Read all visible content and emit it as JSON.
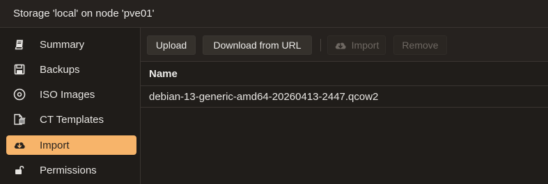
{
  "window": {
    "title": "Storage 'local' on node 'pve01'"
  },
  "sidebar": {
    "items": [
      {
        "label": "Summary",
        "icon": "book-icon"
      },
      {
        "label": "Backups",
        "icon": "floppy-disk-icon"
      },
      {
        "label": "ISO Images",
        "icon": "disc-icon"
      },
      {
        "label": "CT Templates",
        "icon": "container-template-icon"
      },
      {
        "label": "Import",
        "icon": "cloud-download-icon",
        "active": true
      },
      {
        "label": "Permissions",
        "icon": "unlock-icon"
      }
    ]
  },
  "toolbar": {
    "upload_label": "Upload",
    "download_url_label": "Download from URL",
    "import_label": "Import",
    "remove_label": "Remove"
  },
  "grid": {
    "columns": [
      "Name"
    ],
    "rows": [
      {
        "name": "debian-13-generic-amd64-20260413-2447.qcow2"
      }
    ]
  },
  "colors": {
    "accent": "#f7b46a",
    "background": "#1f1c19",
    "header": "#26221f"
  }
}
